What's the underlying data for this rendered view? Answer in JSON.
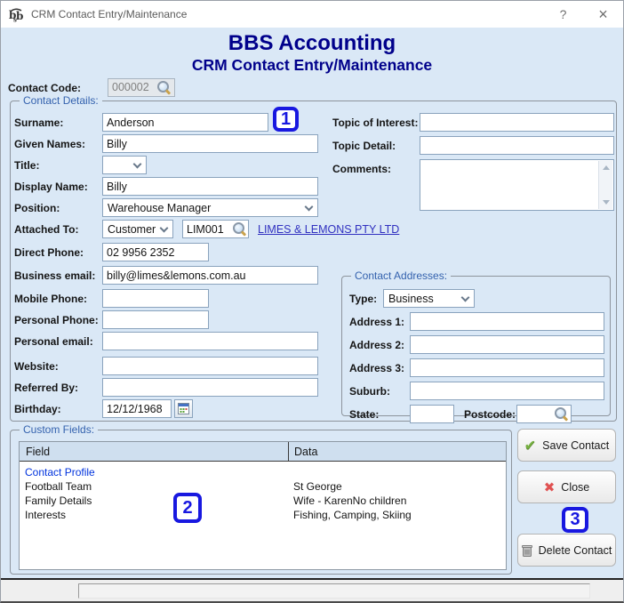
{
  "window": {
    "title": "CRM Contact Entry/Maintenance",
    "help_label": "?",
    "close_label": "×"
  },
  "header": {
    "app_title": "BBS Accounting",
    "screen_title": "CRM Contact Entry/Maintenance"
  },
  "contact_code": {
    "label": "Contact Code:",
    "value": "000002"
  },
  "contact_details": {
    "legend": "Contact Details:",
    "surname": {
      "label": "Surname:",
      "value": "Anderson"
    },
    "given_names": {
      "label": "Given Names:",
      "value": "Billy"
    },
    "title": {
      "label": "Title:",
      "value": ""
    },
    "display_name": {
      "label": "Display Name:",
      "value": "Billy"
    },
    "position": {
      "label": "Position:",
      "value": "Warehouse Manager"
    },
    "attached_to": {
      "label": "Attached To:",
      "type": "Customer",
      "code": "LIM001",
      "link": "LIMES & LEMONS PTY LTD"
    },
    "direct_phone": {
      "label": "Direct Phone:",
      "value": "02 9956 2352"
    },
    "business_email": {
      "label": "Business email:",
      "value": "billy@limes&lemons.com.au"
    },
    "mobile_phone": {
      "label": "Mobile Phone:",
      "value": ""
    },
    "personal_phone": {
      "label": "Personal Phone:",
      "value": ""
    },
    "personal_email": {
      "label": "Personal email:",
      "value": ""
    },
    "website": {
      "label": "Website:",
      "value": ""
    },
    "referred_by": {
      "label": "Referred By:",
      "value": ""
    },
    "birthday": {
      "label": "Birthday:",
      "value": "12/12/1968"
    },
    "topic_of_interest": {
      "label": "Topic of Interest:",
      "value": ""
    },
    "topic_detail": {
      "label": "Topic Detail:",
      "value": ""
    },
    "comments": {
      "label": "Comments:",
      "value": ""
    }
  },
  "addresses": {
    "legend": "Contact Addresses:",
    "type": {
      "label": "Type:",
      "value": "Business"
    },
    "address1": {
      "label": "Address 1:",
      "value": ""
    },
    "address2": {
      "label": "Address 2:",
      "value": ""
    },
    "address3": {
      "label": "Address 3:",
      "value": ""
    },
    "suburb": {
      "label": "Suburb:",
      "value": ""
    },
    "state": {
      "label": "State:",
      "value": ""
    },
    "postcode": {
      "label": "Postcode:",
      "value": ""
    }
  },
  "custom_fields": {
    "legend": "Custom Fields:",
    "headers": [
      "Field",
      "Data"
    ],
    "rows": [
      {
        "field": "Contact Profile",
        "data": ""
      },
      {
        "field": "Football Team",
        "data": "St George"
      },
      {
        "field": "Family Details",
        "data": "Wife - KarenNo children"
      },
      {
        "field": "Interests",
        "data": "Fishing, Camping, Skiing"
      }
    ]
  },
  "buttons": {
    "save": {
      "label": "Save Contact",
      "icon": "✔"
    },
    "close": {
      "label": "Close",
      "icon": "✖"
    },
    "delete": {
      "label": "Delete Contact"
    }
  },
  "annotations": {
    "one": "1",
    "two": "2",
    "three": "3"
  },
  "colors": {
    "heading_navy": "#00008B",
    "legend_blue": "#3462AE",
    "badge_blue": "#1818E0",
    "link_blue": "#3030C0",
    "panel_bg": "#DAE8F6"
  }
}
